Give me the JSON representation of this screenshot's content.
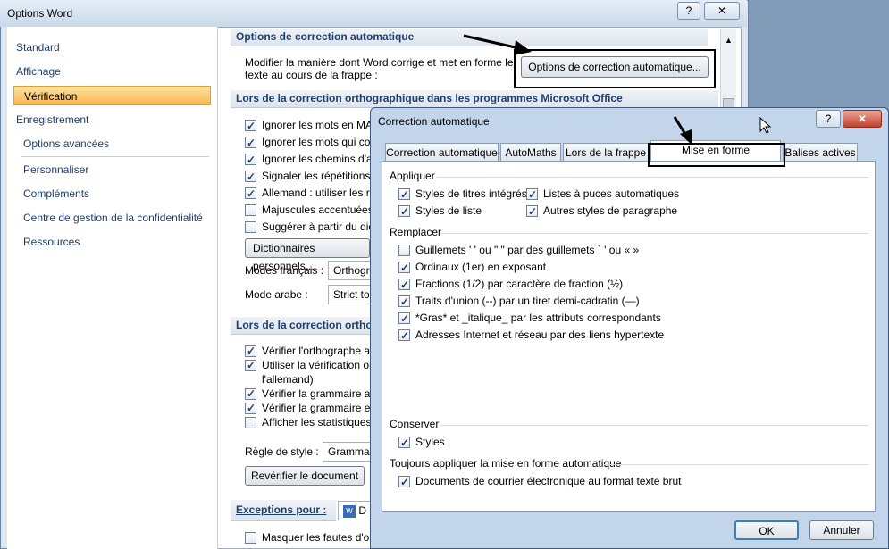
{
  "options_window": {
    "title": "Options Word",
    "help_btn": "?",
    "close_btn": "✕",
    "nav": [
      "Standard",
      "Affichage",
      "Vérification",
      "Enregistrement",
      "Options avancées",
      "Personnaliser",
      "Compléments",
      "Centre de gestion de la confidentialité",
      "Ressources"
    ],
    "section1_title": "Options de correction automatique",
    "section1_desc1": "Modifier la manière dont Word corrige et met en forme le",
    "section1_desc2": "texte au cours de la frappe :",
    "autocorrect_button": "Options de correction automatique...",
    "section2_title": "Lors de la correction orthographique dans les programmes Microsoft Office",
    "section2_items": [
      {
        "label": "Ignorer les mots en MA",
        "checked": true
      },
      {
        "label": "Ignorer les mots qui co",
        "checked": true
      },
      {
        "label": "Ignorer les chemins d'a",
        "checked": true
      },
      {
        "label": "Signaler les répétitions",
        "checked": true
      },
      {
        "label": "Allemand : utiliser les r",
        "checked": true
      },
      {
        "label": "Majuscules accentuées",
        "checked": false
      },
      {
        "label": "Suggérer à partir du dic",
        "checked": false
      }
    ],
    "dictionaries_button": "Dictionnaires personnels...",
    "modes_fr_label": "Modes français :",
    "modes_fr_value": "Orthogr",
    "mode_ar_label": "Mode arabe :",
    "mode_ar_value": "Strict to",
    "section3_title": "Lors de la correction orthog",
    "section3_items": [
      {
        "label": "Vérifier l'orthographe a",
        "checked": true
      },
      {
        "label": "Utiliser la vérification or",
        "checked": true
      },
      {
        "label": "l'allemand)",
        "checked": null
      },
      {
        "label": "Vérifier la grammaire au",
        "checked": true
      },
      {
        "label": "Vérifier la grammaire et",
        "checked": true
      },
      {
        "label": "Afficher les statistiques",
        "checked": false
      }
    ],
    "style_rule_label": "Règle de style :",
    "style_rule_value": "Grammair",
    "recheck_button": "Revérifier le document",
    "exceptions_label": "Exceptions pour :",
    "exceptions_value": "D",
    "hide_errors_label": "Masquer les fautes d'or"
  },
  "dialog": {
    "title": "Correction automatique",
    "help_btn": "?",
    "close_btn": "✕",
    "tabs": [
      "Correction automatique",
      "AutoMaths",
      "Lors de la frappe",
      "Mise en forme automatique",
      "Balises actives"
    ],
    "apply_title": "Appliquer",
    "apply_items": [
      {
        "label": "Styles de titres intégrés",
        "checked": true
      },
      {
        "label": "Listes à puces automatiques",
        "checked": true
      },
      {
        "label": "Styles de liste",
        "checked": true
      },
      {
        "label": "Autres styles de paragraphe",
        "checked": true
      }
    ],
    "replace_title": "Remplacer",
    "replace_items": [
      {
        "label": "Guillemets ' ' ou \" \" par des guillemets ` ' ou « »",
        "checked": false
      },
      {
        "label": "Ordinaux (1er) en exposant",
        "checked": true
      },
      {
        "label": "Fractions (1/2) par caractère de fraction (½)",
        "checked": true
      },
      {
        "label": "Traits d'union (--) par un tiret demi-cadratin (—)",
        "checked": true
      },
      {
        "label": "*Gras* et _italique_ par les attributs correspondants",
        "checked": true
      },
      {
        "label": "Adresses Internet et réseau par des liens hypertexte",
        "checked": true
      }
    ],
    "preserve_title": "Conserver",
    "preserve_items": [
      {
        "label": "Styles",
        "checked": true
      }
    ],
    "always_title": "Toujours appliquer la mise en forme automatique",
    "always_items": [
      {
        "label": "Documents de courrier électronique au format texte brut",
        "checked": true
      }
    ],
    "ok_button": "OK",
    "cancel_button": "Annuler"
  },
  "colors": {
    "nav_active": "#f8b850",
    "link_blue": "#1e3f6e",
    "dialog_frame": "#c3d5ea"
  }
}
